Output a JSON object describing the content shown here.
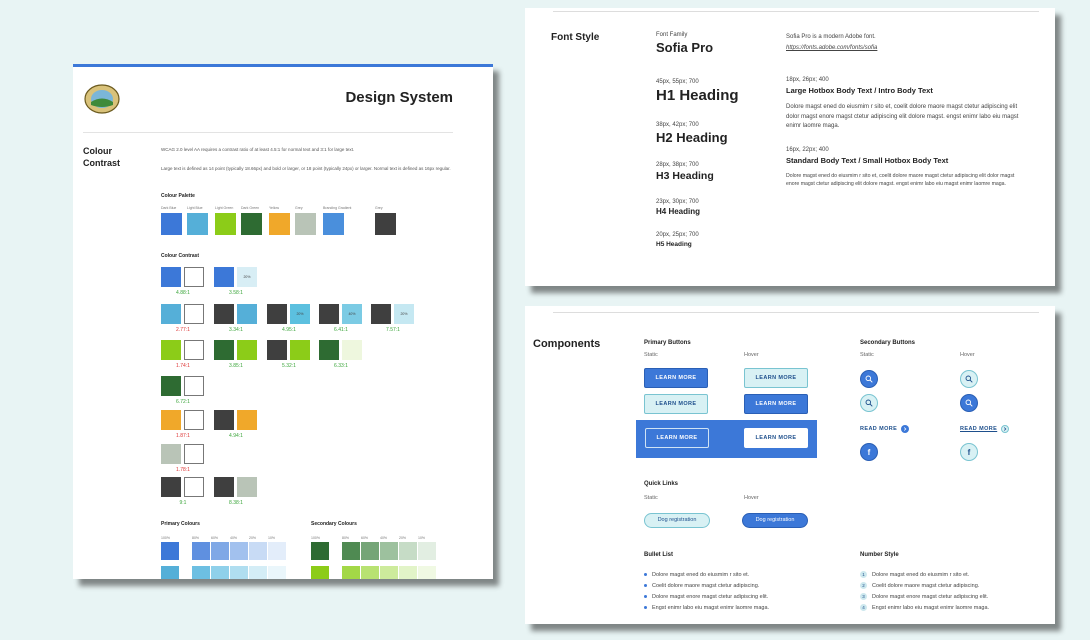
{
  "design": {
    "title": "Design System",
    "section_title_line1": "Colour",
    "section_title_line2": "Contrast",
    "intro1": "WCAG 2.0 level AA requires a contrast ratio of at least 4.5:1 for normal text and 3:1 for large text.",
    "intro2": "Large text is defined as 14 point (typically 18.66px) and bold or larger, or 18 point (typically 24px) or larger. Normal text is defined as 16px regular.",
    "palette_heading": "Colour Palette",
    "palette": [
      {
        "label": "Dark Blue",
        "color": "#3c78d8"
      },
      {
        "label": "Light Blue",
        "color": "#55afd8"
      },
      {
        "label": "Light Green",
        "color": "#8ccc18"
      },
      {
        "label": "Dark Green",
        "color": "#2e6b32"
      },
      {
        "label": "Yellow",
        "color": "#f0a82a"
      },
      {
        "label": "Grey",
        "color": "#b9c4b7"
      },
      {
        "label": "Branding Gradient",
        "color": "#4a8fdc"
      },
      {
        "label": "Grey",
        "color": "#3f3f3f"
      }
    ],
    "contrast_heading": "Colour Contrast",
    "ratios": {
      "r1a": "4.88:1",
      "r1b": "3.58:1",
      "r2a": "2.77:1",
      "r2b": "3.34:1",
      "r2c": "4.95:1",
      "r2d": "6.41:1",
      "r2e": "7.57:1",
      "r3a": "1.74:1",
      "r3b": "3.85:1",
      "r3c": "5.32:1",
      "r3d": "6.33:1",
      "r4a": "6.72:1",
      "r5a": "1.87:1",
      "r5b": "4.94:1",
      "r6a": "1.78:1",
      "r7a": "9:1",
      "r7b": "8.38:1"
    },
    "inner_label": "20%",
    "inner_label_b": "40%",
    "primary_colours_heading": "Primary Colours",
    "secondary_colours_heading": "Secondary Colours",
    "tints": [
      "100%",
      "80%",
      "60%",
      "40%",
      "20%",
      "10%"
    ]
  },
  "font": {
    "section_title": "Font Style",
    "family_label": "Font Family",
    "family_name": "Sofia Pro",
    "family_desc": "Sofia Pro is a modern Adobe font.",
    "family_link": "https://fonts.adobe.com/fonts/sofia",
    "h1_meta": "45px, 55px; 700",
    "h1": "H1 Heading",
    "h2_meta": "38px, 42px; 700",
    "h2": "H2 Heading",
    "h3_meta": "28px, 38px; 700",
    "h3": "H3 Heading",
    "h4_meta": "23px, 30px; 700",
    "h4": "H4 Heading",
    "h5_meta": "20px, 25px; 700",
    "h5": "H5 Heading",
    "large_meta": "18px, 26px; 400",
    "large_title": "Large Hotbox Body Text / Intro Body Text",
    "large_body": "Dolore magst ened do eiusmim r sito et, coelit dolore maore magst ctetur adipiscing elit dolor magst enore magst ctetur adipiscing elit dolore magst. engst enimr labo eiu magst enimr laomre maga.",
    "std_meta": "16px, 22px; 400",
    "std_title": "Standard Body Text / Small Hotbox Body Text",
    "std_body": "Dolore magst ened do eiusmim r sito et, coelit dolore maore magst ctetur adipiscing elit dolor magst enore magst ctetur adipiscing elit dolore magst. engst enimr labo eiu magst enimr laomre maga."
  },
  "comp": {
    "section_title": "Components",
    "primary_buttons": "Primary Buttons",
    "secondary_buttons": "Secondary Buttons",
    "static": "Static",
    "hover": "Hover",
    "learn_more": "LEARN MORE",
    "read_more": "READ MORE",
    "quick_links": "Quick Links",
    "dog_registration": "Dog registration",
    "bullet_list": "Bullet List",
    "number_style": "Number Style",
    "bullets": [
      "Dolore magst ened do eiusmim r sito et.",
      "Coelit dolore maore magst ctetur adipiscing.",
      "Dolore magst enore magst ctetur adipiscing elit.",
      "Engst enimr labo eiu magst enimr laomre maga."
    ],
    "numbered": [
      "Dolore magst ened do eiusmim r sito et.",
      "Coelit dolore maore magst ctetur adipiscing.",
      "Dolore magst enore magst ctetur adipiscing elit.",
      "Engst enimr labo eiu magst enimr laomre maga."
    ],
    "numbers": [
      "1",
      "2",
      "3",
      "4"
    ],
    "facebook_glyph": "f"
  },
  "colors": {
    "dark_blue": "#3c78d8",
    "light_blue": "#55afd8",
    "light_green": "#8ccc18",
    "dark_green": "#2e6b32",
    "yellow": "#f0a82a",
    "grey": "#b9c4b7",
    "charcoal": "#3f3f3f",
    "pass": "#3aa53a",
    "fail": "#dd3333"
  },
  "icons": [
    "logo-seal",
    "search-icon",
    "facebook-icon",
    "chevron-right-icon"
  ]
}
